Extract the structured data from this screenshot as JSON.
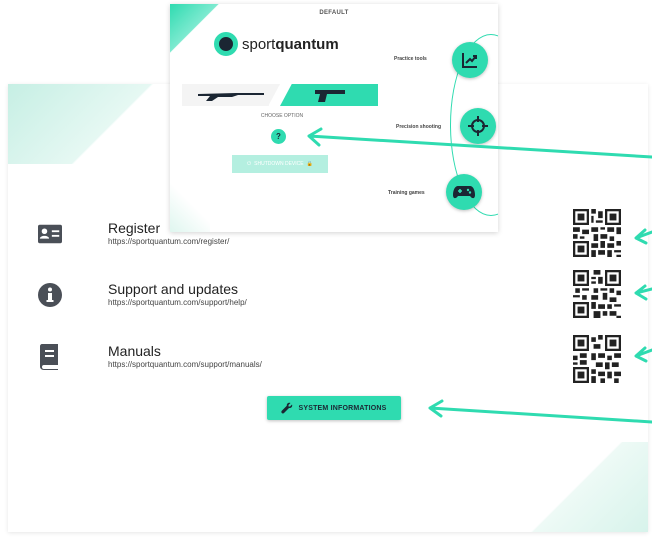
{
  "device": {
    "header": "DEFAULT",
    "logo_text_light": "sport",
    "logo_text_bold": "quantum",
    "choose_option": "CHOOSE OPTION",
    "help_symbol": "?",
    "shutdown_label": "SHUTDOWN DEVICE",
    "modes": [
      {
        "label": "Practice tools",
        "icon": "chart-trend-icon"
      },
      {
        "label": "Precision shooting",
        "icon": "crosshair-icon"
      },
      {
        "label": "Training games",
        "icon": "gamepad-icon"
      }
    ],
    "weapons": [
      {
        "icon": "rifle-icon",
        "selected": false
      },
      {
        "icon": "pistol-icon",
        "selected": true
      }
    ]
  },
  "links": [
    {
      "title": "Register",
      "url": "https://sportquantum.com/register/",
      "icon": "id-card-icon"
    },
    {
      "title": "Support and updates",
      "url": "https://sportquantum.com/support/help/",
      "icon": "info-icon"
    },
    {
      "title": "Manuals",
      "url": "https://sportquantum.com/support/manuals/",
      "icon": "book-icon"
    }
  ],
  "system_button": {
    "label": "SYSTEM INFORMATIONS",
    "icon": "wrench-icon"
  },
  "colors": {
    "accent": "#2fdbb0",
    "dark": "#1b2633",
    "icon_gray": "#4a4f57"
  }
}
